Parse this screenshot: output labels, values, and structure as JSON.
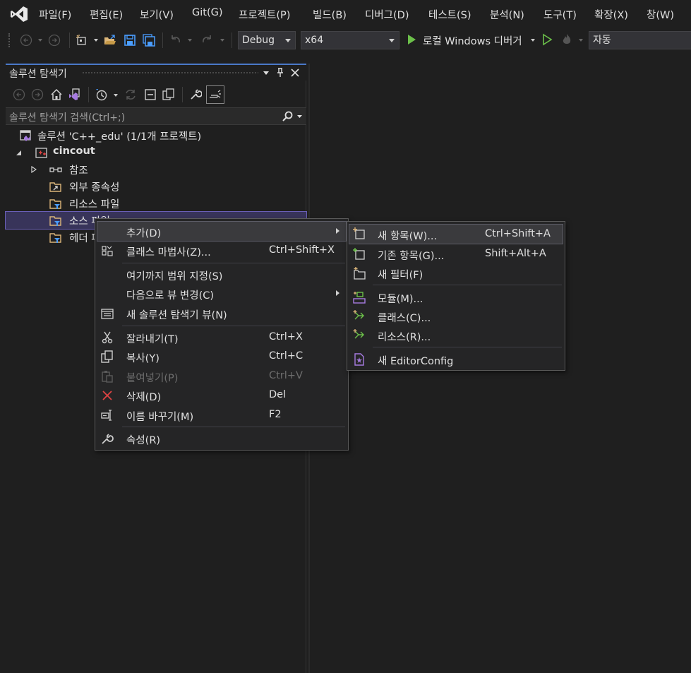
{
  "menubar": {
    "items": [
      "파일(F)",
      "편집(E)",
      "보기(V)",
      "Git(G)",
      "프로젝트(P)",
      "빌드(B)",
      "디버그(D)",
      "테스트(S)",
      "분석(N)",
      "도구(T)",
      "확장(X)",
      "창(W)"
    ]
  },
  "toolbar": {
    "config": "Debug",
    "platform": "x64",
    "run_target": "로컬 Windows 디버거",
    "auto_field": "자동"
  },
  "solution_explorer": {
    "title": "솔루션 탐색기",
    "search_placeholder": "솔루션 탐색기 검색(Ctrl+;)",
    "tree": {
      "solution": "솔루션 'C++_edu' (1/1개 프로젝트)",
      "project": "cincout",
      "references": "참조",
      "external_deps": "외부 종속성",
      "resource_files": "리소스 파일",
      "source_files": "소스 파일",
      "header_files": "헤더 파일"
    }
  },
  "context_menu": {
    "items": [
      {
        "label": "추가(D)",
        "shortcut": ""
      },
      {
        "label": "클래스 마법사(Z)...",
        "shortcut": "Ctrl+Shift+X"
      },
      {
        "label": "여기까지 범위 지정(S)",
        "shortcut": ""
      },
      {
        "label": "다음으로 뷰 변경(C)",
        "shortcut": ""
      },
      {
        "label": "새 솔루션 탐색기 뷰(N)",
        "shortcut": ""
      },
      {
        "label": "잘라내기(T)",
        "shortcut": "Ctrl+X"
      },
      {
        "label": "복사(Y)",
        "shortcut": "Ctrl+C"
      },
      {
        "label": "붙여넣기(P)",
        "shortcut": "Ctrl+V"
      },
      {
        "label": "삭제(D)",
        "shortcut": "Del"
      },
      {
        "label": "이름 바꾸기(M)",
        "shortcut": "F2"
      },
      {
        "label": "속성(R)",
        "shortcut": ""
      }
    ]
  },
  "submenu": {
    "items": [
      {
        "label": "새 항목(W)...",
        "shortcut": "Ctrl+Shift+A"
      },
      {
        "label": "기존 항목(G)...",
        "shortcut": "Shift+Alt+A"
      },
      {
        "label": "새 필터(F)",
        "shortcut": ""
      },
      {
        "label": "모듈(M)...",
        "shortcut": ""
      },
      {
        "label": "클래스(C)...",
        "shortcut": ""
      },
      {
        "label": "리소스(R)...",
        "shortcut": ""
      },
      {
        "label": "새 EditorConfig",
        "shortcut": ""
      }
    ]
  },
  "colors": {
    "background": "#1f1f1f",
    "accent": "#4a78c8",
    "selection": "#38345a",
    "menu_bg": "#252526",
    "run_green": "#6cc04a",
    "folder_yellow": "#dcb67a",
    "delete_red": "#e04343",
    "vs_purple": "#c5a6ff"
  }
}
